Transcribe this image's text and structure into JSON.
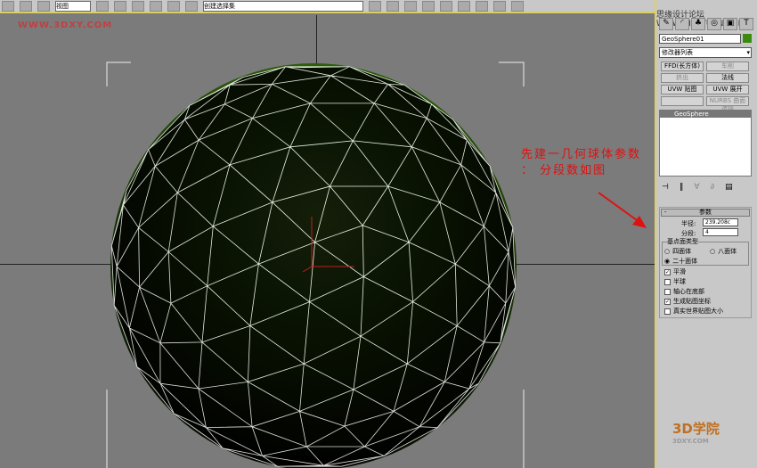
{
  "toolbar": {
    "view_select": "视图",
    "selection_set": "创建选择集"
  },
  "viewport": {
    "watermark": "WWW.3DXY.COM",
    "sphere_color": "#3c7a10",
    "wire_color": "#ffffff"
  },
  "annotation": {
    "text": "先建一几何球体参数 ： 分段数如图",
    "color": "#e01010"
  },
  "panel": {
    "watermark": "思缘设计论坛 WWW.MISSYUAN.COM",
    "object_name": "GeoSphere01",
    "object_color": "#3a8a10",
    "modifier_list": "修改器列表",
    "buttons": [
      "FFD(长方体)",
      "车削",
      "挤出",
      "法线",
      "UVW 贴图",
      "UVW 展开",
      "",
      "NURBS 曲面选择"
    ],
    "stack_item": "GeoSphere",
    "rollout_title": "参数",
    "radius_label": "半径:",
    "radius_value": "239.208c",
    "segments_label": "分段:",
    "segments_value": "4",
    "base_type_label": "基点面类型",
    "types": [
      "四面体",
      "八面体",
      "二十面体"
    ],
    "selected_type": "二十面体",
    "checks": [
      {
        "label": "平滑",
        "checked": true
      },
      {
        "label": "半球",
        "checked": false
      },
      {
        "label": "轴心在底部",
        "checked": false
      },
      {
        "label": "生成贴图坐标",
        "checked": true
      },
      {
        "label": "真实世界贴图大小",
        "checked": false
      }
    ]
  },
  "footer_watermark": {
    "title": "3D学院",
    "url": "3DXY.COM"
  }
}
